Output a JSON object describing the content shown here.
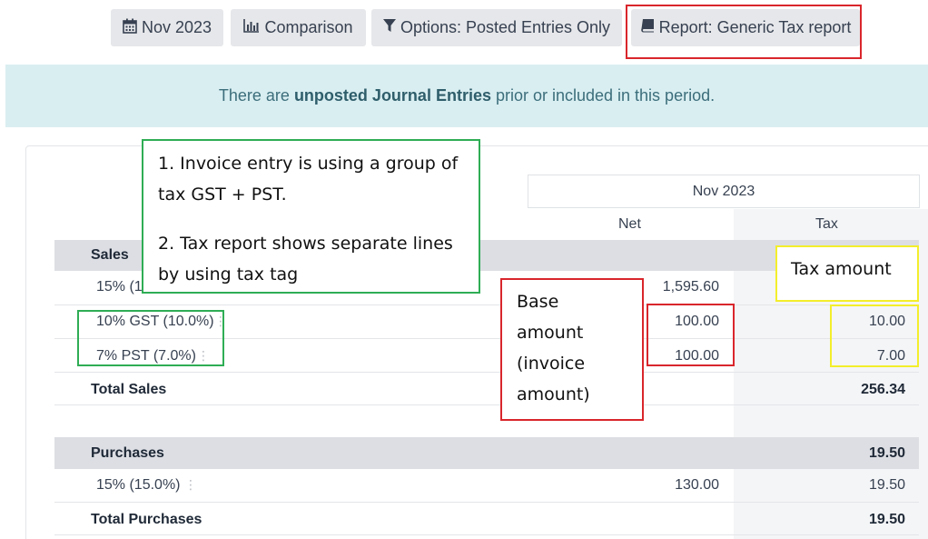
{
  "toolbar": {
    "period_label": "Nov 2023",
    "comparison_label": "Comparison",
    "options_label": "Options: Posted Entries Only",
    "report_label": "Report: Generic Tax report"
  },
  "banner": {
    "prefix": "There are ",
    "link": "unposted Journal Entries",
    "suffix": " prior or included in this period."
  },
  "table": {
    "period_header": "Nov 2023",
    "col_net": "Net",
    "col_tax": "Tax",
    "sales": {
      "title": "Sales",
      "rows": [
        {
          "label": "15% (1",
          "net": "1,595.60",
          "tax": ""
        },
        {
          "label": "10% GST (10.0%)",
          "net": "100.00",
          "tax": "10.00"
        },
        {
          "label": "7% PST (7.0%)",
          "net": "100.00",
          "tax": "7.00"
        }
      ],
      "total_label": "Total Sales",
      "total_tax": "256.34"
    },
    "purchases": {
      "title": "Purchases",
      "header_tax": "19.50",
      "rows": [
        {
          "label": "15% (15.0%)",
          "net": "130.00",
          "tax": "19.50"
        }
      ],
      "total_label": "Total Purchases",
      "total_tax": "19.50"
    }
  },
  "annotations": {
    "green_note_line1": "1. Invoice entry is using a group of",
    "green_note_line2": "tax GST + PST.",
    "green_note_line3": "2. Tax report shows separate lines",
    "green_note_line4": "by using tax tag",
    "base_line1": "Base",
    "base_line2": "amount",
    "base_line3": "(invoice",
    "base_line4": "amount)",
    "tax_amount": "Tax amount"
  },
  "colors": {
    "annotation_red": "#d9262c",
    "annotation_green": "#2fad55",
    "annotation_yellow": "#f3ee2b",
    "banner_bg": "#d9eef1"
  }
}
